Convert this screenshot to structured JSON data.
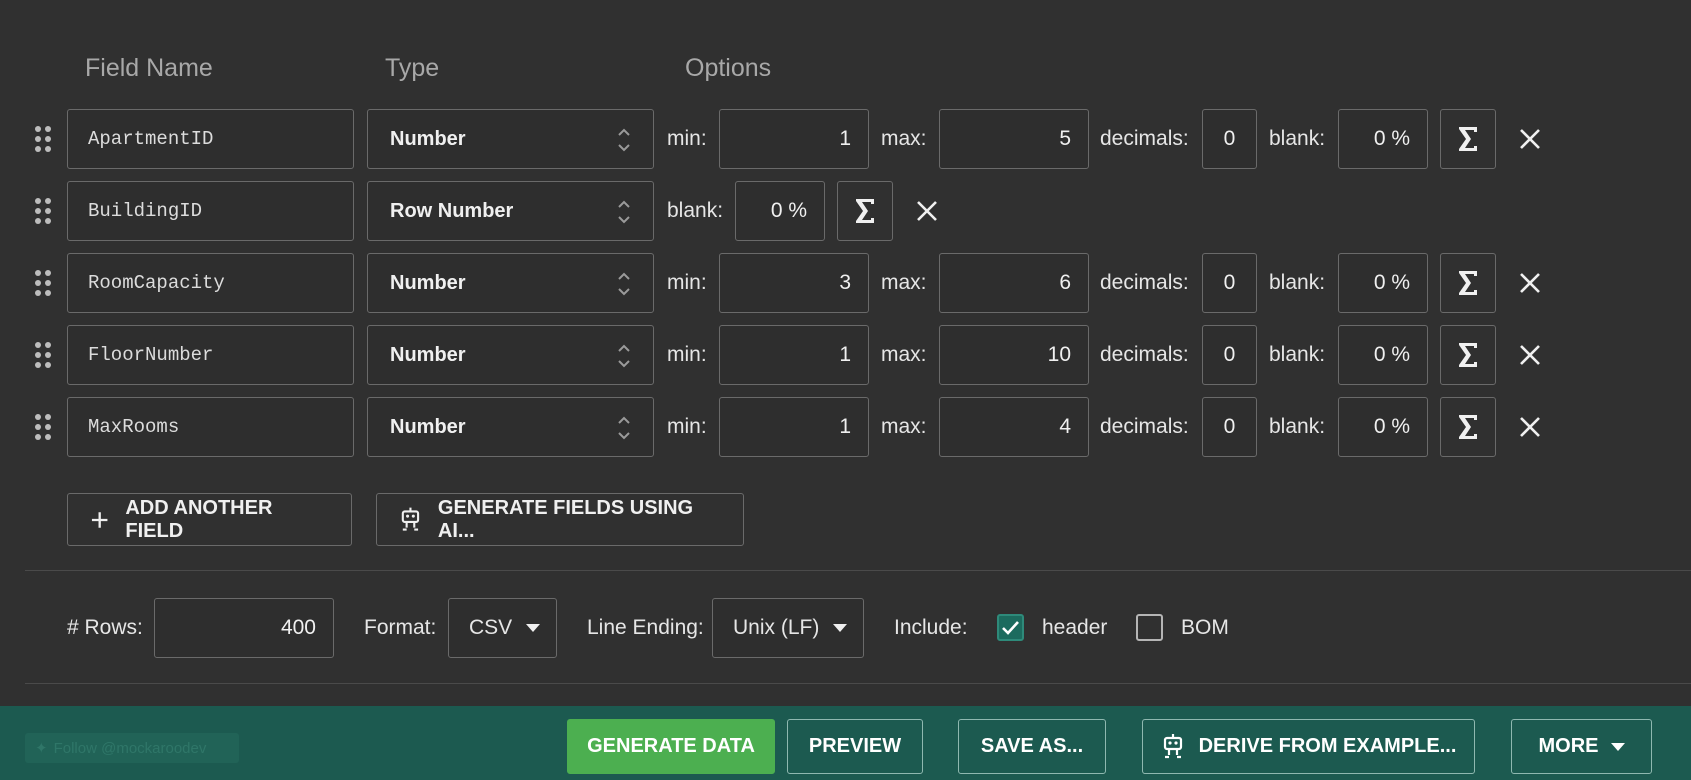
{
  "columns": {
    "field_name": "Field Name",
    "type": "Type",
    "options": "Options"
  },
  "labels": {
    "min": "min:",
    "max": "max:",
    "decimals": "decimals:",
    "blank": "blank:"
  },
  "fields": [
    {
      "name": "ApartmentID",
      "type": "Number",
      "min": "1",
      "max": "5",
      "decimals": "0",
      "blank": "0 %"
    },
    {
      "name": "BuildingID",
      "type": "Row Number",
      "blank": "0 %"
    },
    {
      "name": "RoomCapacity",
      "type": "Number",
      "min": "3",
      "max": "6",
      "decimals": "0",
      "blank": "0 %"
    },
    {
      "name": "FloorNumber",
      "type": "Number",
      "min": "1",
      "max": "10",
      "decimals": "0",
      "blank": "0 %"
    },
    {
      "name": "MaxRooms",
      "type": "Number",
      "min": "1",
      "max": "4",
      "decimals": "0",
      "blank": "0 %"
    }
  ],
  "actions": {
    "add_field": "ADD ANOTHER FIELD",
    "generate_ai": "GENERATE FIELDS USING AI..."
  },
  "settings": {
    "rows_label": "# Rows:",
    "rows_value": "400",
    "format_label": "Format:",
    "format_value": "CSV",
    "line_ending_label": "Line Ending:",
    "line_ending_value": "Unix (LF)",
    "include_label": "Include:",
    "header_label": "header",
    "header_checked": true,
    "bom_label": "BOM",
    "bom_checked": false
  },
  "footer": {
    "twitter": "Follow @mockaroodev",
    "generate": "GENERATE DATA",
    "preview": "PREVIEW",
    "save_as": "SAVE AS...",
    "derive": "DERIVE FROM EXAMPLE...",
    "more": "MORE"
  },
  "colors": {
    "background": "#303030",
    "footer": "#1c5a50",
    "generate_button": "#4caf50",
    "checkbox_checked": "#1c6b5e"
  }
}
